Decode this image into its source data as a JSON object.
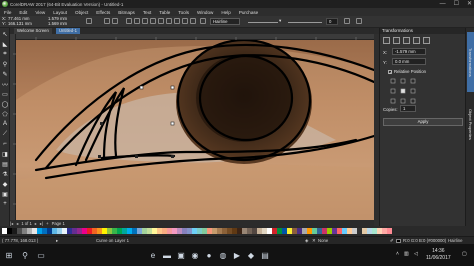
{
  "titlebar": {
    "title": "CorelDRAW 2017 (64-Bit Evaluation Version) - Untitled-1"
  },
  "window_buttons": {
    "minimize": "—",
    "maximize": "☐",
    "close": "✕"
  },
  "menu": [
    "File",
    "Edit",
    "View",
    "Layout",
    "Object",
    "Effects",
    "Bitmaps",
    "Text",
    "Table",
    "Tools",
    "Window",
    "Help",
    "Purchase"
  ],
  "propbar": {
    "x": "77.461 mm",
    "y": "166.131 mm",
    "w": "1.579 mm",
    "h": "1.569 mm",
    "outline_style": "Hairline",
    "smoothing": "0"
  },
  "tabs": [
    {
      "label": "Welcome Screen",
      "active": false
    },
    {
      "label": "Untitled-1",
      "active": true
    }
  ],
  "docker": {
    "title": "Transformations",
    "x_field": "-1.579 mm",
    "y_field": "0.0 mm",
    "relative_label": "Relative Position",
    "copies_label": "Copies:",
    "copies_value": "1",
    "apply_label": "Apply"
  },
  "sidetabs": [
    "Transformations",
    "Object Properties"
  ],
  "pagebar": {
    "page_label": "Page 1",
    "of": "1 of 1"
  },
  "palette_colors": [
    "#ffffff",
    "#000000",
    "#1a1a1a",
    "#4d4d4d",
    "#808080",
    "#b3b3b3",
    "#e6e6e6",
    "#00a0e9",
    "#0070c0",
    "#003a8c",
    "#5fb8e6",
    "#9ad0ec",
    "#e8f4fa",
    "#2e3192",
    "#662d91",
    "#92278f",
    "#ec008c",
    "#ed1c24",
    "#f26522",
    "#f7941d",
    "#fff200",
    "#8dc63f",
    "#39b54a",
    "#00a651",
    "#00a99d",
    "#00aeef",
    "#0072bc",
    "#7da7d9",
    "#a3d39c",
    "#c4df9b",
    "#fff799",
    "#fdc689",
    "#f9ad81",
    "#f6989d",
    "#f49ac2",
    "#bd8cbf",
    "#8781bd",
    "#8393ca",
    "#6dcff6",
    "#7accc8",
    "#82ca9c",
    "#f7977a",
    "#c69c6d",
    "#a67c52",
    "#8c6239",
    "#754c24",
    "#603913",
    "#3c2415",
    "#998675",
    "#736357",
    "#534741",
    "#c7b299",
    "#e1d5c1",
    "#ffffff",
    "#d2232a",
    "#00923f",
    "#0054a6",
    "#f9ed32",
    "#8b5e3c",
    "#4b2e83",
    "#aaaaaa",
    "#ff9900",
    "#66cc99",
    "#336699",
    "#cc3366",
    "#99cc00",
    "#663399",
    "#ff6666",
    "#66ccff",
    "#ffcc99",
    "#cccccc",
    "#333333",
    "#e3c9a6",
    "#b7d7e8",
    "#a8e6cf",
    "#ffd3b6",
    "#ffaaa5",
    "#ff8b94"
  ],
  "status": {
    "coords": "( 77.778, 168.013 )",
    "object": "Curve on Layer 1",
    "fill_label": "None",
    "color_readout": "R:0 G:0 B:0 (#000000)",
    "outline": "Hairline"
  },
  "taskbar": {
    "time": "14:36",
    "date": "11/06/2017"
  }
}
